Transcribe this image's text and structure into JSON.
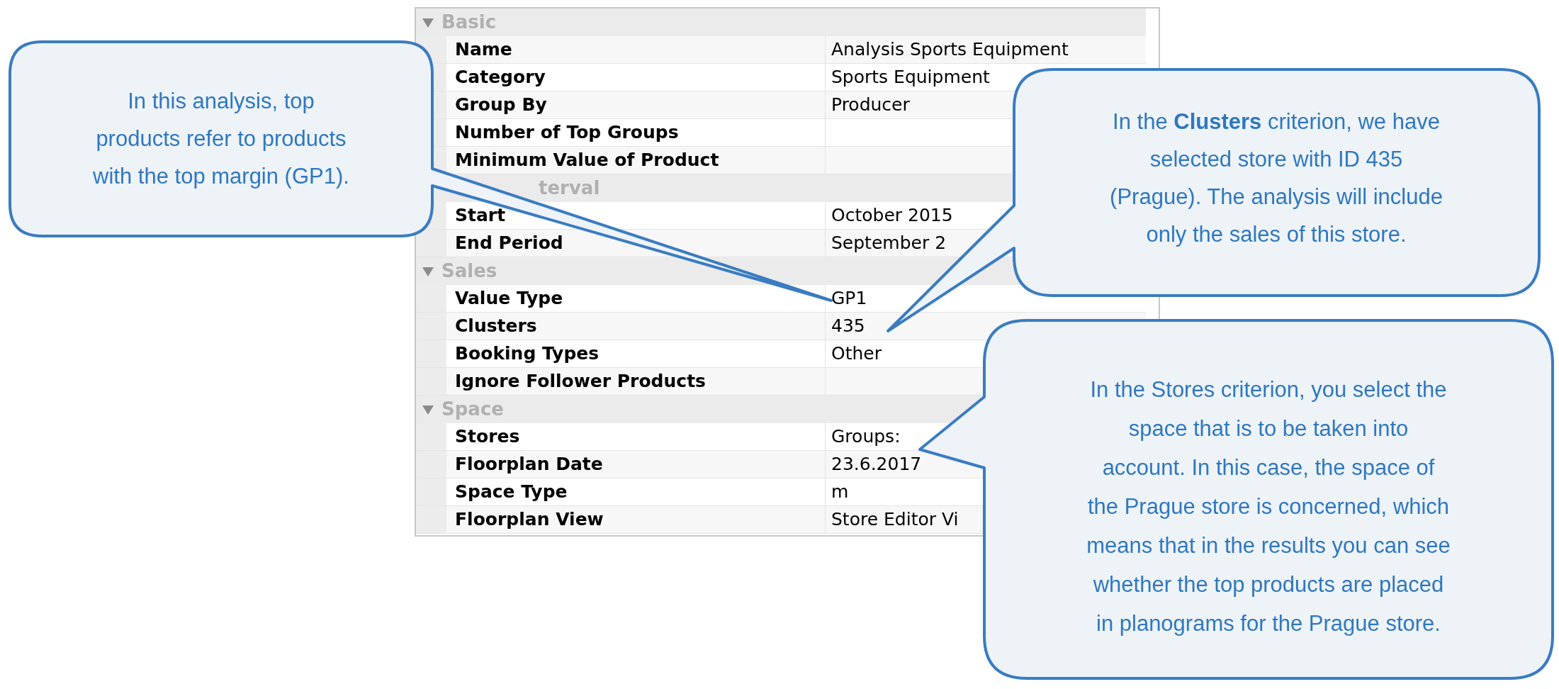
{
  "property_groups": [
    {
      "label": "Basic",
      "expanded": true,
      "kind": "full",
      "rows": [
        {
          "key": "Name",
          "value": "Analysis Sports Equipment"
        },
        {
          "key": "Category",
          "value": "Sports Equipment"
        },
        {
          "key": "Group By",
          "value": "Producer"
        },
        {
          "key": "Number of Top Groups"
        },
        {
          "key": "Minimum Value of Product"
        }
      ]
    },
    {
      "label": "terval",
      "kind": "clipped",
      "rows": [
        {
          "key": "Start",
          "value": "October 2015"
        },
        {
          "key": "End Period",
          "value": "September 2"
        }
      ]
    },
    {
      "label": "Sales",
      "expanded": true,
      "kind": "full",
      "rows": [
        {
          "key": "Value Type",
          "value": "GP1"
        },
        {
          "key": "Clusters",
          "value": "435"
        },
        {
          "key": "Booking Types",
          "value": "Other"
        },
        {
          "key": "Ignore Follower Products"
        }
      ]
    },
    {
      "label": "Space",
      "expanded": true,
      "kind": "full",
      "rows": [
        {
          "key": "Stores",
          "value": "Groups:"
        },
        {
          "key": "Floorplan Date",
          "value": "23.6.2017"
        },
        {
          "key": "Space Type",
          "value": "m"
        },
        {
          "key": "Floorplan View",
          "value": "Store Editor Vi"
        }
      ]
    }
  ],
  "callouts": [
    {
      "text": "In this analysis, top\nproducts refer to products\nwith the top margin (GP1)."
    },
    {
      "text": "In the **Clusters** criterion, we have\nselected store with ID 435\n(Prague). The analysis will include\nonly the sales of this store."
    },
    {
      "text": "In the Stores criterion, you select the\nspace that is to be taken into\naccount. In this case, the space of\nthe Prague store is concerned, which\nmeans that in the results you can see\nwhether the top products are placed\nin planograms for the Prague store."
    }
  ]
}
